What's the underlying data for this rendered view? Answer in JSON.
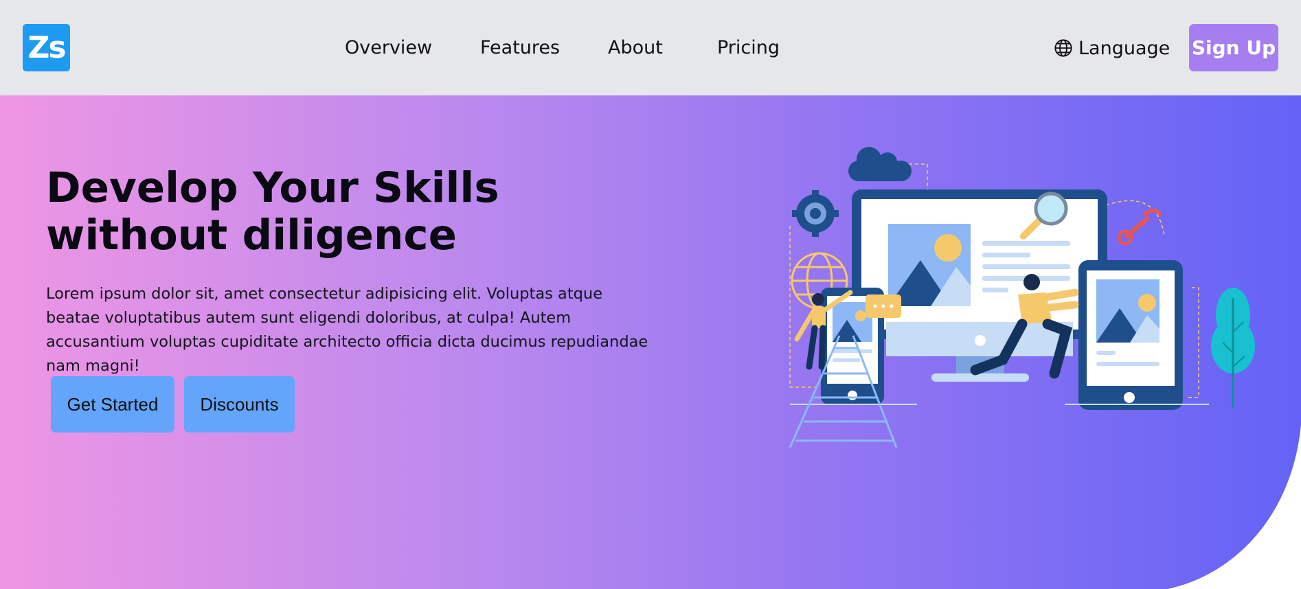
{
  "brand": {
    "logo_text": "Zs"
  },
  "nav": {
    "links": [
      "Overview",
      "Features",
      "About",
      "Pricing"
    ],
    "language_label": "Language",
    "signup_label": "Sign Up"
  },
  "hero": {
    "title_line1": "Develop Your Skills",
    "title_line2": "without diligence",
    "description": "Lorem ipsum dolor sit, amet consectetur adipisicing elit. Voluptas atque beatae voluptatibus autem sunt eligendi doloribus, at culpa! Autem accusantium voluptas cupiditate architecto officia dicta ducimus repudiandae nam magni!",
    "primary_button": "Get Started",
    "secondary_button": "Discounts"
  },
  "icons": {
    "language": "globe-icon",
    "illustration": "devices-people-illustration"
  },
  "colors": {
    "navbar_bg": "#e5e7eb",
    "logo_bg": "#1d9bf0",
    "signup_bg": "#a57ff0",
    "hero_gradient_start": "#ee96e4",
    "hero_gradient_end": "#6463f6",
    "button_bg": "#63a5fa"
  }
}
